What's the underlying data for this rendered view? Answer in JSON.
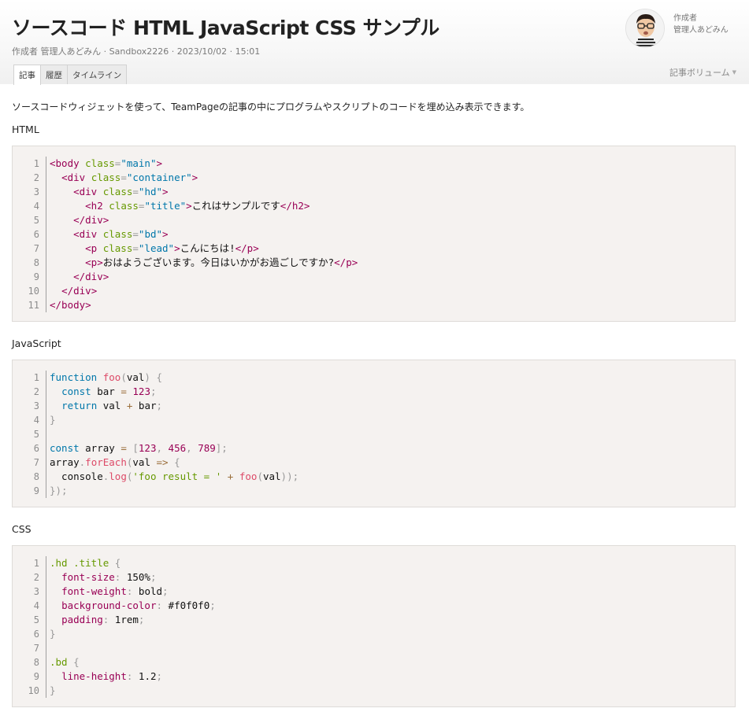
{
  "page": {
    "title": "ソースコード HTML JavaScript CSS サンプル",
    "meta": "作成者 管理人あどみん · Sandbox2226 · 2023/10/02 · 15:01",
    "author_label": "作成者",
    "author_name": "管理人あどみん",
    "volume_label": "記事ボリューム"
  },
  "tabs": [
    {
      "label": "記事",
      "active": true
    },
    {
      "label": "履歴",
      "active": false
    },
    {
      "label": "タイムライン",
      "active": false
    }
  ],
  "content": {
    "intro": "ソースコードウィジェットを使って、TeamPageの記事の中にプログラムやスクリプトのコードを埋め込み表示できます。",
    "sections": [
      {
        "title": "HTML",
        "lines": [
          [
            [
              "tag",
              "<body "
            ],
            [
              "attr",
              "class"
            ],
            [
              "punct",
              "="
            ],
            [
              "str",
              "\"main\""
            ],
            [
              "tag",
              ">"
            ]
          ],
          [
            [
              "text",
              "  "
            ],
            [
              "tag",
              "<div "
            ],
            [
              "attr",
              "class"
            ],
            [
              "punct",
              "="
            ],
            [
              "str",
              "\"container\""
            ],
            [
              "tag",
              ">"
            ]
          ],
          [
            [
              "text",
              "    "
            ],
            [
              "tag",
              "<div "
            ],
            [
              "attr",
              "class"
            ],
            [
              "punct",
              "="
            ],
            [
              "str",
              "\"hd\""
            ],
            [
              "tag",
              ">"
            ]
          ],
          [
            [
              "text",
              "      "
            ],
            [
              "tag",
              "<h2 "
            ],
            [
              "attr",
              "class"
            ],
            [
              "punct",
              "="
            ],
            [
              "str",
              "\"title\""
            ],
            [
              "tag",
              ">"
            ],
            [
              "text",
              "これはサンプルです"
            ],
            [
              "tag",
              "</h2>"
            ]
          ],
          [
            [
              "text",
              "    "
            ],
            [
              "tag",
              "</div>"
            ]
          ],
          [
            [
              "text",
              "    "
            ],
            [
              "tag",
              "<div "
            ],
            [
              "attr",
              "class"
            ],
            [
              "punct",
              "="
            ],
            [
              "str",
              "\"bd\""
            ],
            [
              "tag",
              ">"
            ]
          ],
          [
            [
              "text",
              "      "
            ],
            [
              "tag",
              "<p "
            ],
            [
              "attr",
              "class"
            ],
            [
              "punct",
              "="
            ],
            [
              "str",
              "\"lead\""
            ],
            [
              "tag",
              ">"
            ],
            [
              "text",
              "こんにちは!"
            ],
            [
              "tag",
              "</p>"
            ]
          ],
          [
            [
              "text",
              "      "
            ],
            [
              "tag",
              "<p>"
            ],
            [
              "text",
              "おはようございます。今日はいかがお過ごしですか?"
            ],
            [
              "tag",
              "</p>"
            ]
          ],
          [
            [
              "text",
              "    "
            ],
            [
              "tag",
              "</div>"
            ]
          ],
          [
            [
              "text",
              "  "
            ],
            [
              "tag",
              "</div>"
            ]
          ],
          [
            [
              "tag",
              "</body>"
            ]
          ]
        ]
      },
      {
        "title": "JavaScript",
        "lines": [
          [
            [
              "kw",
              "function "
            ],
            [
              "fn",
              "foo"
            ],
            [
              "punct",
              "("
            ],
            [
              "text",
              "val"
            ],
            [
              "punct",
              ")"
            ],
            [
              "text",
              " "
            ],
            [
              "punct",
              "{"
            ]
          ],
          [
            [
              "text",
              "  "
            ],
            [
              "kw",
              "const "
            ],
            [
              "text",
              "bar "
            ],
            [
              "op",
              "="
            ],
            [
              "text",
              " "
            ],
            [
              "num",
              "123"
            ],
            [
              "punct",
              ";"
            ]
          ],
          [
            [
              "text",
              "  "
            ],
            [
              "kw",
              "return "
            ],
            [
              "text",
              "val "
            ],
            [
              "op",
              "+"
            ],
            [
              "text",
              " bar"
            ],
            [
              "punct",
              ";"
            ]
          ],
          [
            [
              "punct",
              "}"
            ]
          ],
          [],
          [
            [
              "kw",
              "const "
            ],
            [
              "text",
              "array "
            ],
            [
              "op",
              "="
            ],
            [
              "text",
              " "
            ],
            [
              "punct",
              "["
            ],
            [
              "num",
              "123"
            ],
            [
              "punct",
              ","
            ],
            [
              "text",
              " "
            ],
            [
              "num",
              "456"
            ],
            [
              "punct",
              ","
            ],
            [
              "text",
              " "
            ],
            [
              "num",
              "789"
            ],
            [
              "punct",
              "];"
            ]
          ],
          [
            [
              "text",
              "array"
            ],
            [
              "punct",
              "."
            ],
            [
              "fn",
              "forEach"
            ],
            [
              "punct",
              "("
            ],
            [
              "text",
              "val "
            ],
            [
              "op",
              "=>"
            ],
            [
              "text",
              " "
            ],
            [
              "punct",
              "{"
            ]
          ],
          [
            [
              "text",
              "  console"
            ],
            [
              "punct",
              "."
            ],
            [
              "fn",
              "log"
            ],
            [
              "punct",
              "("
            ],
            [
              "jstr",
              "'foo result = '"
            ],
            [
              "text",
              " "
            ],
            [
              "op",
              "+"
            ],
            [
              "text",
              " "
            ],
            [
              "fn",
              "foo"
            ],
            [
              "punct",
              "("
            ],
            [
              "text",
              "val"
            ],
            [
              "punct",
              "));"
            ]
          ],
          [
            [
              "punct",
              "});"
            ]
          ]
        ]
      },
      {
        "title": "CSS",
        "lines": [
          [
            [
              "sel",
              ".hd .title "
            ],
            [
              "punct",
              "{"
            ]
          ],
          [
            [
              "text",
              "  "
            ],
            [
              "prop",
              "font-size"
            ],
            [
              "punct",
              ":"
            ],
            [
              "text",
              " 150%"
            ],
            [
              "punct",
              ";"
            ]
          ],
          [
            [
              "text",
              "  "
            ],
            [
              "prop",
              "font-weight"
            ],
            [
              "punct",
              ":"
            ],
            [
              "text",
              " bold"
            ],
            [
              "punct",
              ";"
            ]
          ],
          [
            [
              "text",
              "  "
            ],
            [
              "prop",
              "background-color"
            ],
            [
              "punct",
              ":"
            ],
            [
              "text",
              " #f0f0f0"
            ],
            [
              "punct",
              ";"
            ]
          ],
          [
            [
              "text",
              "  "
            ],
            [
              "prop",
              "padding"
            ],
            [
              "punct",
              ":"
            ],
            [
              "text",
              " 1rem"
            ],
            [
              "punct",
              ";"
            ]
          ],
          [
            [
              "punct",
              "}"
            ]
          ],
          [],
          [
            [
              "sel",
              ".bd "
            ],
            [
              "punct",
              "{"
            ]
          ],
          [
            [
              "text",
              "  "
            ],
            [
              "prop",
              "line-height"
            ],
            [
              "punct",
              ":"
            ],
            [
              "text",
              " 1.2"
            ],
            [
              "punct",
              ";"
            ]
          ],
          [
            [
              "punct",
              "}"
            ]
          ]
        ]
      }
    ]
  }
}
